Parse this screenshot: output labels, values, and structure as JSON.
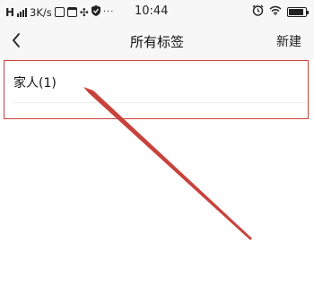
{
  "status_bar": {
    "signal_text": "H",
    "network_speed": "3K/s",
    "time": "10:44"
  },
  "nav": {
    "back_icon": "chevron-left-icon",
    "title": "所有标签",
    "new_label": "新建"
  },
  "tags": [
    {
      "label": "家人(1)"
    }
  ],
  "colors": {
    "highlight": "#c8423c",
    "nav_background": "#f7f7f7"
  }
}
